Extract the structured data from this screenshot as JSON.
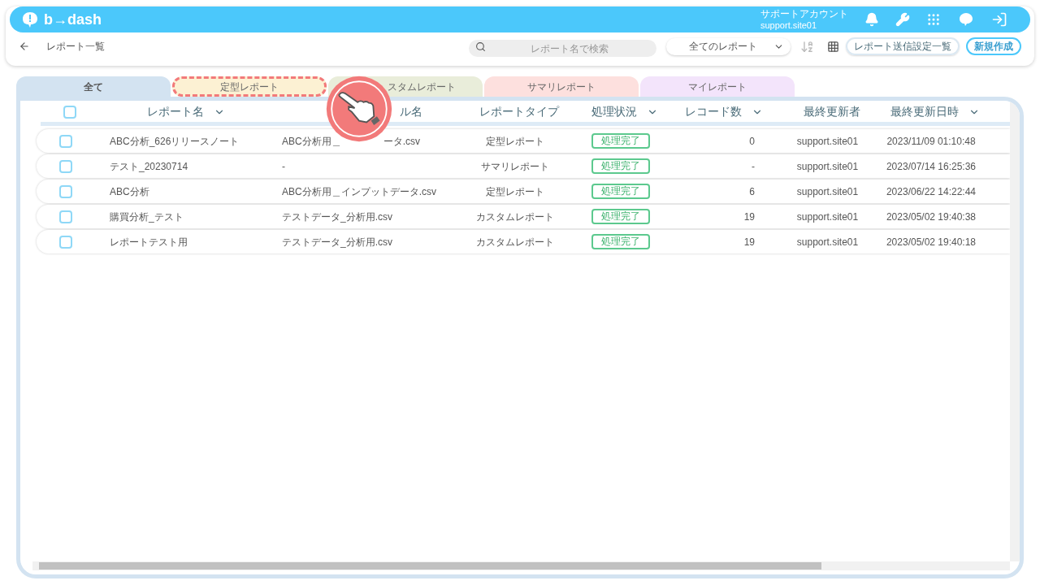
{
  "header": {
    "logo": "b→dash",
    "account_label": "サポートアカウント",
    "account_user": "support.site01"
  },
  "toolbar": {
    "title": "レポート一覧",
    "search_placeholder": "レポート名で検索",
    "filter_value": "全てのレポート",
    "buttons": [
      {
        "label": "レポート送信設定一覧",
        "kind": "outline"
      },
      {
        "label": "新規作成",
        "kind": "primary"
      }
    ]
  },
  "tabs": [
    {
      "label": "全て",
      "selected": true,
      "highlighted": false,
      "color": "#d3e3f1"
    },
    {
      "label": "定型レポート",
      "selected": false,
      "highlighted": true,
      "color": "#fcf1d3"
    },
    {
      "label": "スタムレポート",
      "selected": false,
      "highlighted": false,
      "color": "#e9edda"
    },
    {
      "label": "サマリレポート",
      "selected": false,
      "highlighted": false,
      "color": "#fde0de"
    },
    {
      "label": "マイレポート",
      "selected": false,
      "highlighted": false,
      "color": "#f3e4fb"
    }
  ],
  "table": {
    "header_checked": false,
    "columns": [
      {
        "label": "レポート名",
        "sortable": true
      },
      {
        "label": "ル名",
        "sortable": false
      },
      {
        "label": "レポートタイプ",
        "sortable": false
      },
      {
        "label": "処理状況",
        "sortable": true
      },
      {
        "label": "レコード数",
        "sortable": true
      },
      {
        "label": "最終更新者",
        "sortable": false
      },
      {
        "label": "最終更新日時",
        "sortable": true
      }
    ],
    "rows": [
      {
        "checked": false,
        "name": "ABC分析_626リリースノート",
        "file": [
          "ABC分析用＿",
          "ータ.csv"
        ],
        "type": "定型レポート",
        "status": "処理完了",
        "records": "0",
        "updater": "support.site01",
        "updated": "2023/11/09 01:10:48"
      },
      {
        "checked": false,
        "name": "テスト_20230714",
        "file": [
          "-"
        ],
        "type": "サマリレポート",
        "status": "処理完了",
        "records": "-",
        "updater": "support.site01",
        "updated": "2023/07/14 16:25:36"
      },
      {
        "checked": false,
        "name": "ABC分析",
        "file": [
          "ABC分析用＿インプットデータ.csv"
        ],
        "type": "定型レポート",
        "status": "処理完了",
        "records": "6",
        "updater": "support.site01",
        "updated": "2023/06/22 14:22:44"
      },
      {
        "checked": false,
        "name": "購買分析_テスト",
        "file": [
          "テストデータ_分析用.csv"
        ],
        "type": "カスタムレポート",
        "status": "処理完了",
        "records": "19",
        "updater": "support.site01",
        "updated": "2023/05/02 19:40:38"
      },
      {
        "checked": false,
        "name": "レポートテスト用",
        "file": [
          "テストデータ_分析用.csv"
        ],
        "type": "カスタムレポート",
        "status": "処理完了",
        "records": "19",
        "updater": "support.site01",
        "updated": "2023/05/02 19:40:18"
      }
    ]
  }
}
